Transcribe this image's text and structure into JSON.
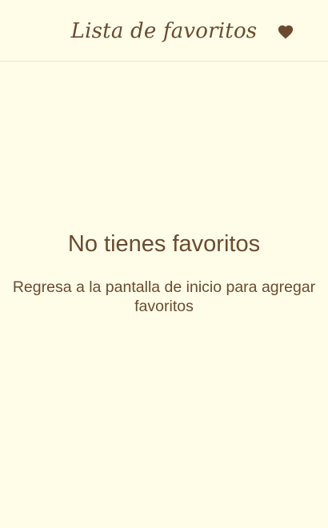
{
  "header": {
    "title": "Lista de favoritos",
    "favorites_icon": "heart-icon"
  },
  "empty_state": {
    "title": "No tienes favoritos",
    "message": "Regresa a la pantalla de inicio para agregar favoritos"
  },
  "colors": {
    "background": "#fffde8",
    "text": "#6b4a31",
    "divider": "#e6e2cf"
  }
}
